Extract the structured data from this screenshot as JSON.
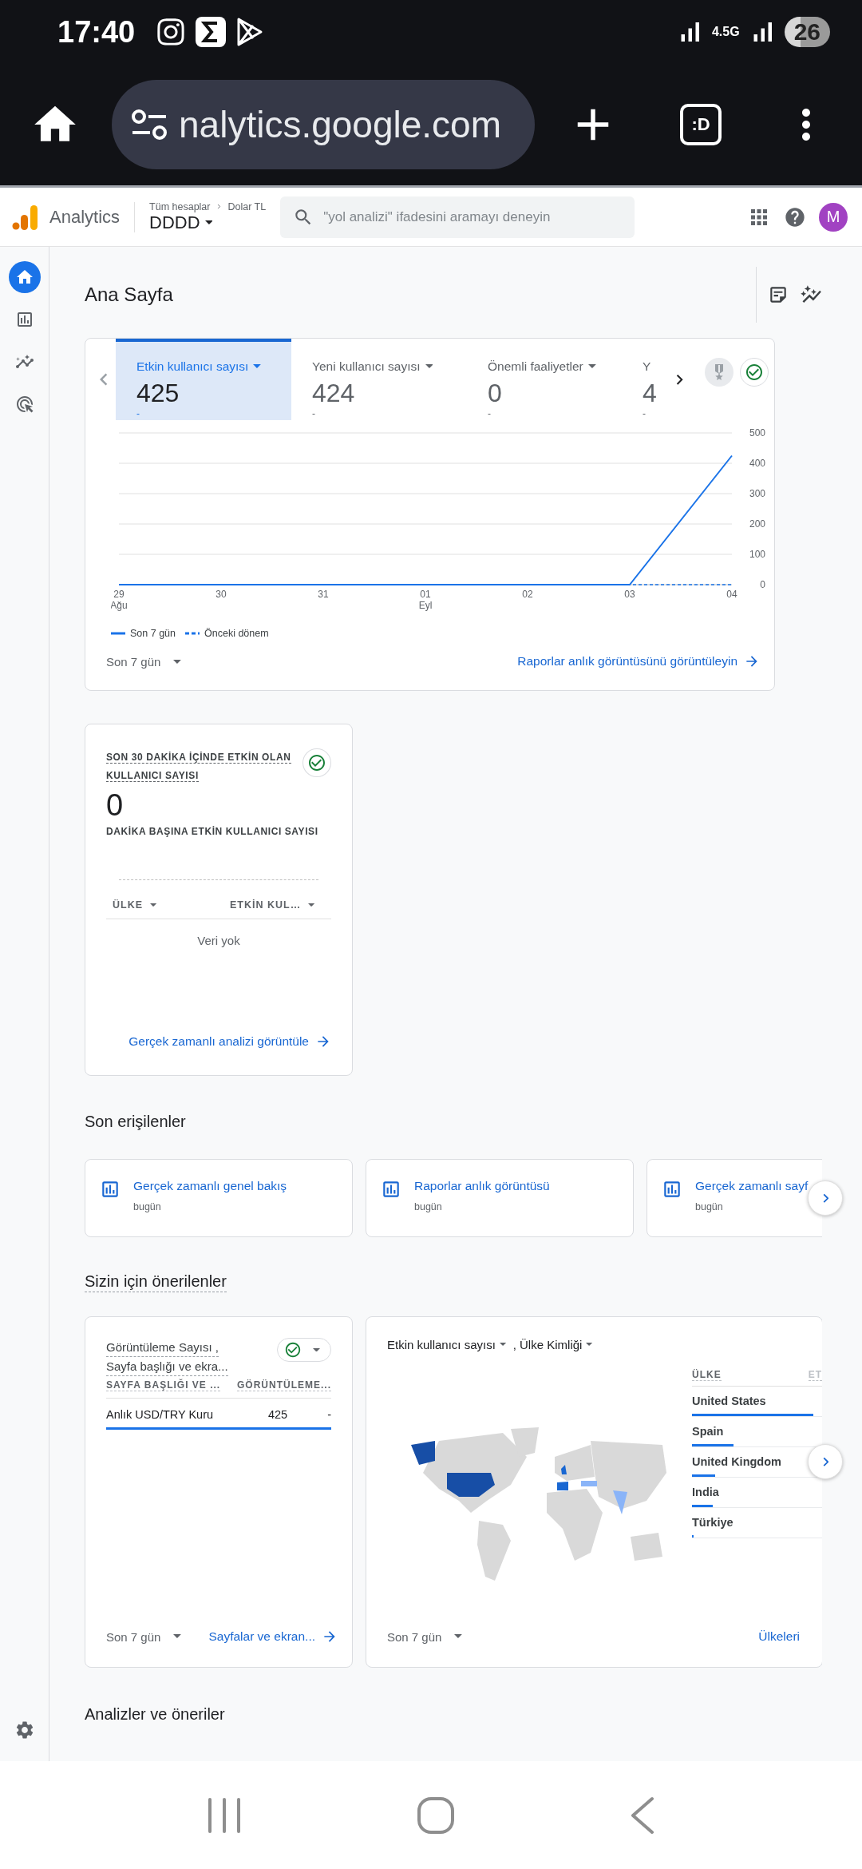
{
  "status_bar": {
    "time": "17:40",
    "network": "4.5G",
    "battery": "26"
  },
  "browser": {
    "url": "nalytics.google.com",
    "tabs_label": ":D"
  },
  "header": {
    "product": "Analytics",
    "breadcrumb": [
      "Tüm hesaplar",
      "Dolar TL"
    ],
    "property": "DDDD",
    "search": {
      "placeholder": "\"yol analizi\" ifadesini aramayı deneyin"
    },
    "avatar": "M"
  },
  "nav_rail": {
    "items": [
      {
        "kind": "home",
        "selected": true
      },
      {
        "kind": "reports",
        "selected": false
      },
      {
        "kind": "explore",
        "selected": false
      },
      {
        "kind": "advertising",
        "selected": false
      }
    ]
  },
  "page_title": "Ana Sayfa",
  "overview_card": {
    "metrics": [
      {
        "label": "Etkin kullanıcı sayısı",
        "value": "425",
        "change": "-",
        "selected": true
      },
      {
        "label": "Yeni kullanıcı sayısı",
        "value": "424",
        "change": "-",
        "selected": false
      },
      {
        "label": "Önemli faaliyetler",
        "value": "0",
        "change": "-",
        "selected": false
      },
      {
        "label": "Y",
        "value": "4",
        "change": "-",
        "selected": false
      }
    ],
    "chart_data": {
      "type": "line",
      "grid": true,
      "categories": [
        "29\nAğu",
        "30",
        "31",
        "01\nEyl",
        "02",
        "03",
        "04"
      ],
      "ylim": [
        0,
        500
      ],
      "yticks": [
        0,
        100,
        200,
        300,
        400,
        500
      ],
      "series": [
        {
          "name": "Son 7 gün",
          "color": "#1a73e8",
          "line_style": "solid",
          "values": [
            0,
            0,
            0,
            0,
            0,
            0,
            425
          ]
        },
        {
          "name": "Önceki dönem",
          "color": "#1a73e8",
          "line_style": "dashed",
          "values": [
            0,
            0,
            0,
            0,
            0,
            0,
            0
          ]
        }
      ]
    },
    "date_range": "Son 7 gün",
    "link": "Raporlar anlık görüntüsünü görüntüleyin"
  },
  "realtime_card": {
    "title": "SON 30 DAKİKA İÇİNDE ETKİN OLAN KULLANICI SAYISI",
    "value": "0",
    "subtitle": "DAKİKA BAŞINA ETKİN KULLANICI SAYISI",
    "columns": [
      "ÜLKE",
      "ETKİN KUL…"
    ],
    "empty_text": "Veri yok",
    "link": "Gerçek zamanlı analizi görüntüle"
  },
  "recent": {
    "title": "Son erişilenler",
    "items": [
      {
        "title": "Gerçek zamanlı genel bakış",
        "time": "bugün"
      },
      {
        "title": "Raporlar anlık görüntüsü",
        "time": "bugün"
      },
      {
        "title": "Gerçek zamanlı sayf",
        "time": "bugün"
      }
    ]
  },
  "recommended": {
    "title": "Sizin için önerilenler",
    "pages_card": {
      "title_lines": [
        "Görüntüleme Sayısı ,",
        "Sayfa başlığı ve ekra..."
      ],
      "columns": [
        "SAYFA BAŞLIĞI VE ...",
        "GÖRÜNTÜLEME..."
      ],
      "rows": [
        {
          "cells": [
            "Anlık USD/TRY Kuru",
            "425",
            "-"
          ],
          "level": 1
        }
      ],
      "date_range": "Son 7 gün",
      "link": "Sayfalar ve ekran..."
    },
    "countries_card": {
      "metric": "Etkin kullanıcı sayısı",
      "dimension": ", Ülke Kimliği",
      "columns": [
        "ÜLKE",
        "ET"
      ],
      "rows": [
        {
          "name": "United States",
          "level": 0.93
        },
        {
          "name": "Spain",
          "level": 0.32
        },
        {
          "name": "United Kingdom",
          "level": 0.18
        },
        {
          "name": "India",
          "level": 0.16
        },
        {
          "name": "Türkiye",
          "level": 0.01
        }
      ],
      "date_range": "Son 7 gün",
      "link": "Ülkeleri"
    }
  },
  "insights": {
    "title": "Analizler ve öneriler"
  }
}
